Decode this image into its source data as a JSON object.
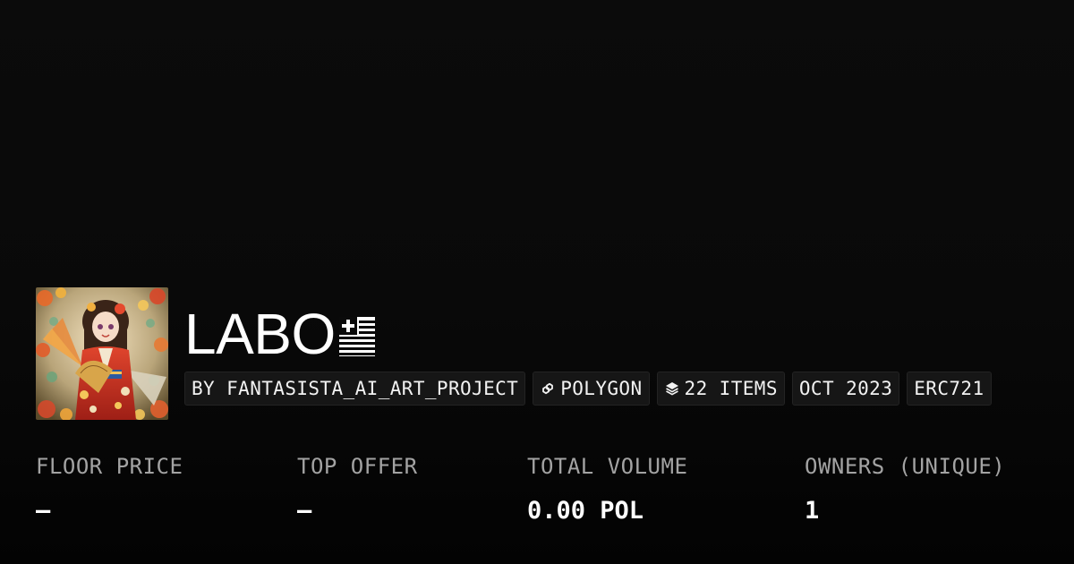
{
  "collection": {
    "title": "LABO",
    "title_flag_icon": "flag-icon",
    "avatar_icon": "collection-avatar-artwork"
  },
  "chips": [
    {
      "label": "BY FANTASISTA_AI_ART_PROJECT",
      "icon": null
    },
    {
      "label": "POLYGON",
      "icon": "polygon-chain-icon"
    },
    {
      "label": "22 ITEMS",
      "icon": "layers-icon"
    },
    {
      "label": "OCT 2023",
      "icon": null
    },
    {
      "label": "ERC721",
      "icon": null
    }
  ],
  "stats": [
    {
      "label": "FLOOR PRICE",
      "value": "–"
    },
    {
      "label": "TOP OFFER",
      "value": "–"
    },
    {
      "label": "TOTAL VOLUME",
      "value": "0.00 POL"
    },
    {
      "label": "OWNERS (UNIQUE)",
      "value": "1"
    }
  ],
  "colors": {
    "background": "#0a0a0a",
    "chip_background": "#161616",
    "label_gray": "#a3a3a3",
    "text_white": "#ffffff"
  }
}
